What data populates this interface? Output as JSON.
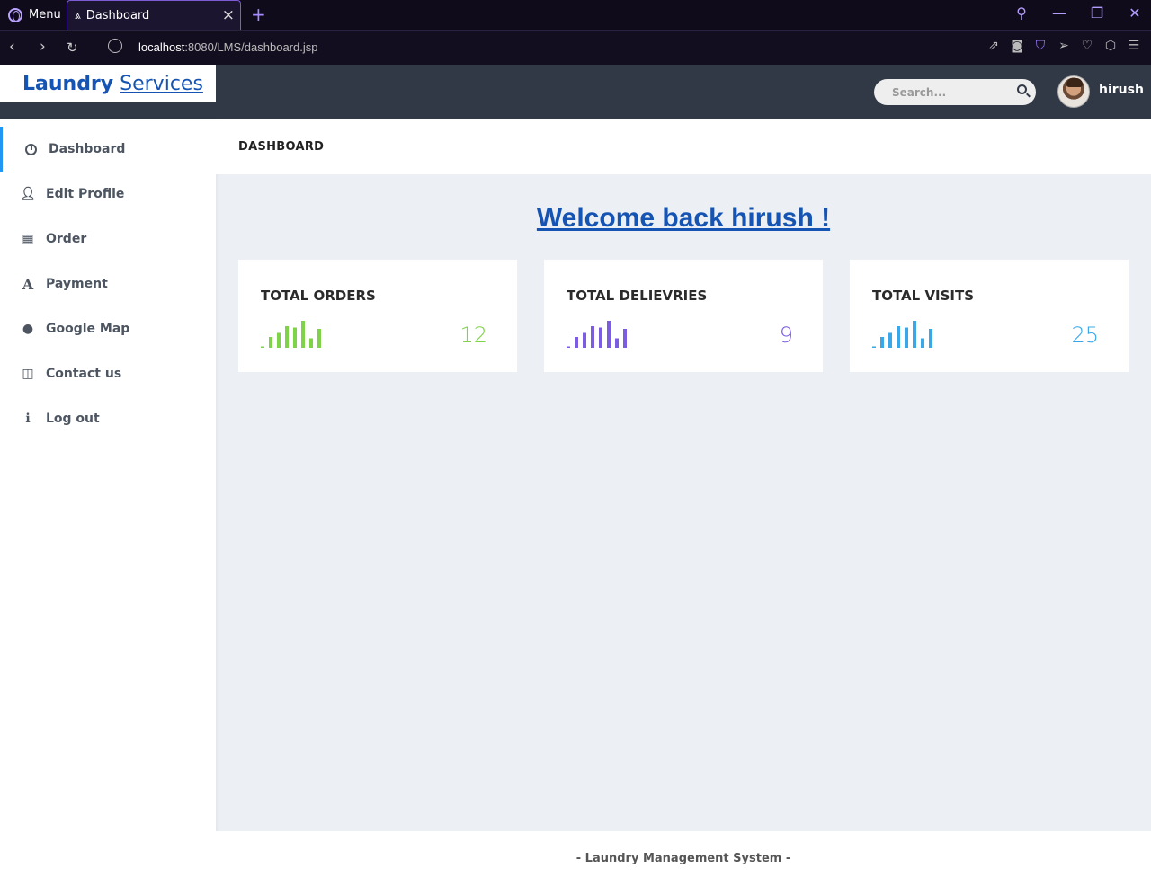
{
  "browser": {
    "menu_label": "Menu",
    "tab_title": "Dashboard",
    "url_host": "localhost",
    "url_rest": ":8080/LMS/dashboard.jsp"
  },
  "app": {
    "logo_main": "Laundry",
    "logo_sub": "Services",
    "search_placeholder": "Search...",
    "username": "hirush"
  },
  "sidebar": {
    "items": [
      {
        "label": "Dashboard",
        "icon": "clock-icon"
      },
      {
        "label": "Edit Profile",
        "icon": "user-icon"
      },
      {
        "label": "Order",
        "icon": "table-icon"
      },
      {
        "label": "Payment",
        "icon": "font-icon"
      },
      {
        "label": "Google Map",
        "icon": "globe-icon"
      },
      {
        "label": "Contact us",
        "icon": "columns-icon"
      },
      {
        "label": "Log out",
        "icon": "info-icon"
      }
    ]
  },
  "breadcrumb": "DASHBOARD",
  "welcome": "Welcome back hirush !",
  "cards": [
    {
      "title": "TOTAL ORDERS",
      "value": "12",
      "color": "#7ed348",
      "bars": [
        0.05,
        0.4,
        0.55,
        0.8,
        0.75,
        1.0,
        0.35,
        0.7
      ]
    },
    {
      "title": "TOTAL DELIEVRIES",
      "value": "9",
      "color": "#7c5ce0",
      "bars": [
        0.05,
        0.4,
        0.55,
        0.8,
        0.75,
        1.0,
        0.35,
        0.7
      ]
    },
    {
      "title": "TOTAL VISITS",
      "value": "25",
      "color": "#3aa8e8",
      "bars": [
        0.05,
        0.4,
        0.55,
        0.8,
        0.75,
        1.0,
        0.35,
        0.7
      ]
    }
  ],
  "footer": "- Laundry Management System -"
}
